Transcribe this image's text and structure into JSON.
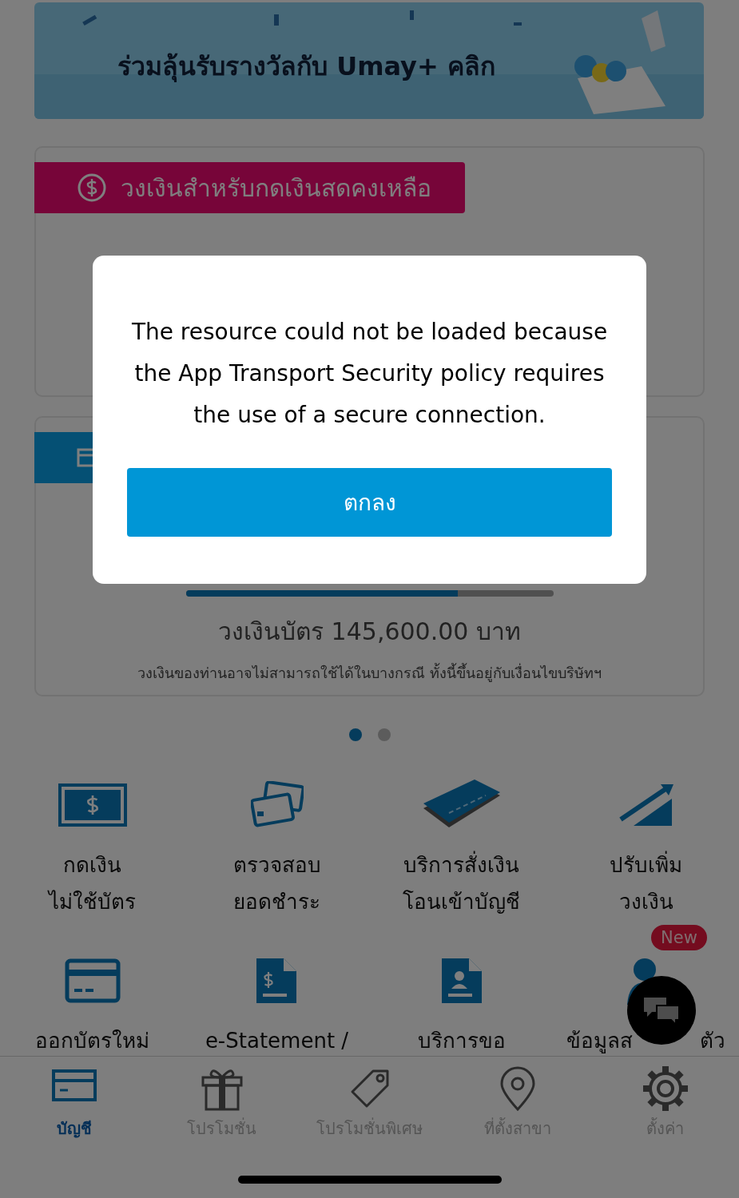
{
  "banner": {
    "text": "ร่วมลุ้นรับรางวัลกับ Umay+ คลิก"
  },
  "cash_card": {
    "title": "วงเงินสำหรับกดเงินสดคงเหลือ"
  },
  "credit_card": {
    "level": 0.74,
    "limit_text": "วงเงินบัตร 145,600.00 บาท",
    "note": "วงเงินของท่านอาจไม่สามารถใช้ได้ในบางกรณี ทั้งนี้ขึ้นอยู่กับเงื่อนไขบริษัทฯ"
  },
  "carousel_dots": [
    {
      "selected": true
    },
    {
      "selected": false
    }
  ],
  "services": [
    {
      "kind": "cash",
      "lines": [
        "กดเงิน",
        "ไม่ใช้บัตร"
      ]
    },
    {
      "kind": "cards",
      "lines": [
        "ตรวจสอบ",
        "ยอดชำระ"
      ]
    },
    {
      "kind": "bankbook",
      "lines": [
        "บริการสั่งเงิน",
        "โอนเข้าบัญชี"
      ]
    },
    {
      "kind": "increase",
      "lines": [
        "ปรับเพิ่ม",
        "วงเงิน"
      ]
    },
    {
      "kind": "card",
      "lines": [
        "ออกบัตรใหม่"
      ]
    },
    {
      "kind": "statement",
      "lines": [
        "e-Statement /"
      ]
    },
    {
      "kind": "document",
      "lines": [
        "บริการขอ"
      ]
    },
    {
      "kind": "person",
      "label_parts": [
        "ข้อมูลส",
        "ตัว"
      ],
      "badge": "New"
    }
  ],
  "tab_bar": [
    {
      "kind": "card",
      "label": "บัญชี",
      "selected": true
    },
    {
      "kind": "gift",
      "label": "โปรโมชั่น",
      "selected": false
    },
    {
      "kind": "tag",
      "label": "โปรโมชั่นพิเศษ",
      "selected": false
    },
    {
      "kind": "pin",
      "label": "ที่ตั้งสาขา",
      "selected": false
    },
    {
      "kind": "gear",
      "label": "ตั้งค่า",
      "selected": false
    }
  ],
  "dialog": {
    "message": "The resource could not be loaded because the App Transport Security policy requires the use of a secure connection.",
    "button": "ตกลง"
  }
}
